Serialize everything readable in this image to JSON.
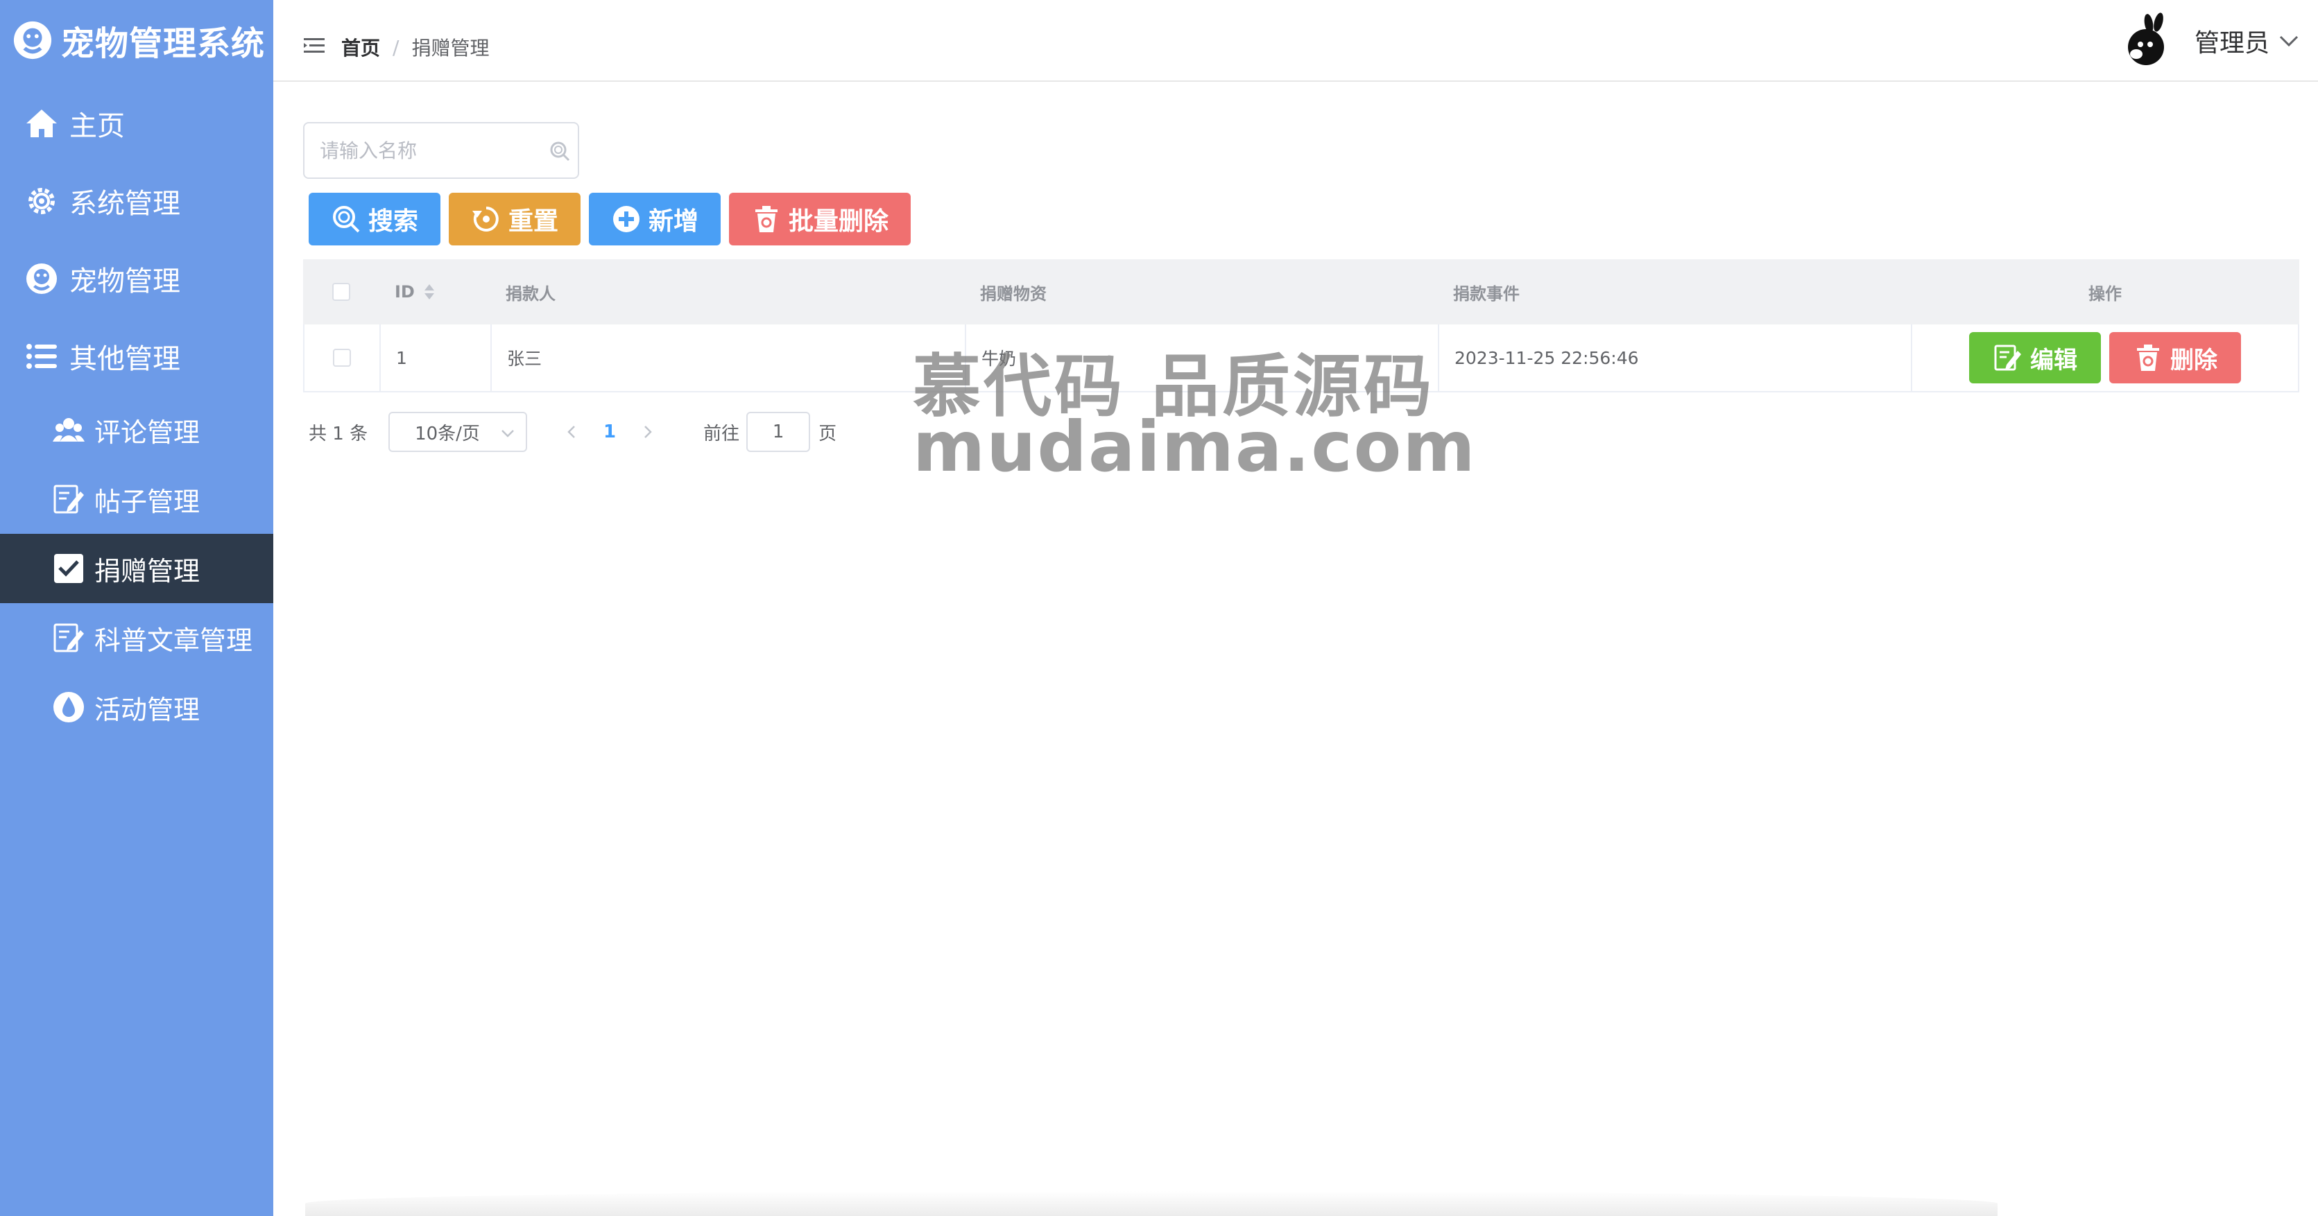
{
  "app": {
    "title": "宠物管理系统"
  },
  "sidebar": {
    "items": [
      {
        "label": "主页",
        "icon": "home-icon"
      },
      {
        "label": "系统管理",
        "icon": "gear-icon"
      },
      {
        "label": "宠物管理",
        "icon": "pet-icon"
      },
      {
        "label": "其他管理",
        "icon": "list-icon"
      }
    ],
    "sub_items": [
      {
        "label": "评论管理",
        "icon": "users-icon"
      },
      {
        "label": "帖子管理",
        "icon": "edit-icon"
      },
      {
        "label": "捐赠管理",
        "icon": "check-square-icon",
        "active": true
      },
      {
        "label": "科普文章管理",
        "icon": "edit-icon"
      },
      {
        "label": "活动管理",
        "icon": "drop-icon"
      }
    ],
    "colors": {
      "background": "#6d9be8",
      "active": "#2d3a4b"
    }
  },
  "header": {
    "breadcrumb": {
      "home": "首页",
      "separator": "/",
      "current": "捐赠管理"
    },
    "username": "管理员"
  },
  "search": {
    "placeholder": "请输入名称",
    "value": ""
  },
  "toolbar": {
    "search_label": "搜索",
    "reset_label": "重置",
    "add_label": "新增",
    "batch_delete_label": "批量删除"
  },
  "table": {
    "columns": {
      "id": "ID",
      "donor": "捐款人",
      "goods": "捐赠物资",
      "time": "捐款事件",
      "ops": "操作"
    },
    "rows": [
      {
        "id": "1",
        "donor": "张三",
        "goods": "牛奶",
        "time": "2023-11-25 22:56:46"
      }
    ],
    "edit_label": "编辑",
    "delete_label": "删除"
  },
  "pagination": {
    "total_text": "共 1 条",
    "page_size": "10条/页",
    "current_page": "1",
    "goto_label": "前往",
    "goto_value": "1",
    "page_suffix": "页"
  },
  "watermark": {
    "line1": "慕代码 品质源码",
    "line2": "mudaima.com"
  }
}
